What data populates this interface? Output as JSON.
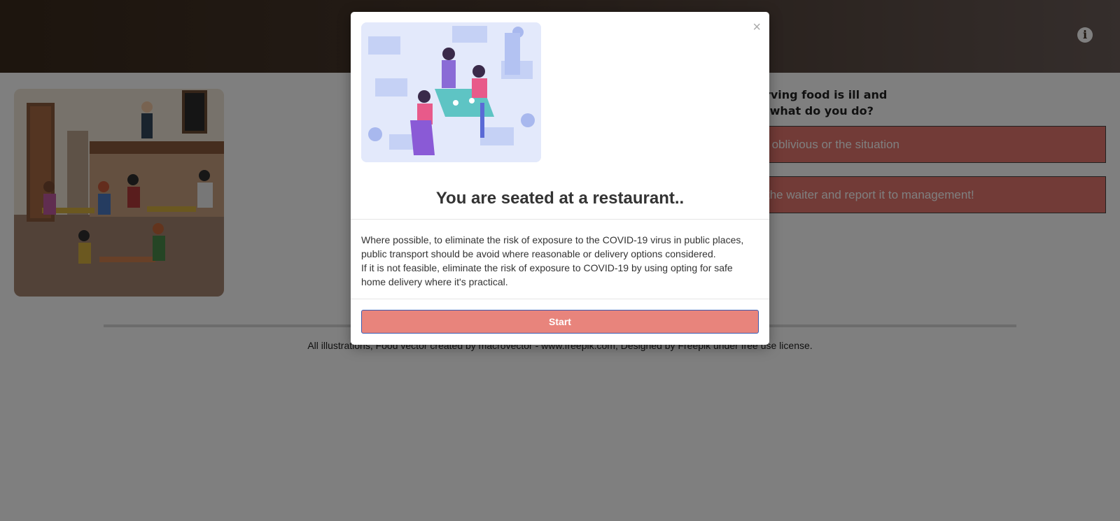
{
  "question": {
    "line1": "waiters serving food is ill and",
    "line2": "estaurant, what do you do?"
  },
  "answers": [
    "main oblivious or the situation",
    "rom the waiter and report it to management!"
  ],
  "credit": "All illustrations, Food vector created by macrovector - www.freepik.com, Designed by Freepik under free use license.",
  "modal": {
    "close_glyph": "×",
    "title": "You are seated at a restaurant..",
    "body_lines": [
      "Where possible, to eliminate the risk of exposure to the COVID-19 virus in public places,",
      "public transport should be avoid where reasonable or delivery options considered.",
      "If it is not feasible, eliminate the risk of exposure to COVID-19 by using opting for safe",
      "home delivery where it's practical."
    ],
    "start_label": "Start"
  },
  "info_glyph": "i",
  "colors": {
    "header": "#3a2a1c",
    "accent": "#e8847c",
    "answer_bg": "#e4766e"
  }
}
